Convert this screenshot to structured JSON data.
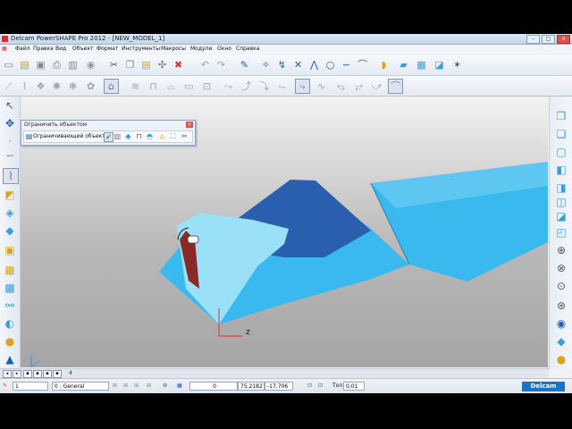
{
  "window": {
    "title": "Delcam PowerSHAPE Pro 2012 - [NEW_MODEL_1]",
    "minimize": "–",
    "maximize": "□",
    "close": "×"
  },
  "menu": [
    "Файл",
    "Правка",
    "Вид",
    "Объект",
    "Формат",
    "Инструменты",
    "Макросы",
    "Модули",
    "Окно",
    "Справка"
  ],
  "dialog": {
    "title": "Ограничить объектом",
    "close": "×",
    "limiting_label": "Ограничивающий объект"
  },
  "tabs": {
    "count_label": "4"
  },
  "status": {
    "level_value": "1",
    "layer_value": "0 : General",
    "field_value_1": "0",
    "x": "75,2182",
    "y": "-17,706",
    "tol_label": "Tол",
    "tol_value": "0,01"
  },
  "logo": {
    "text": "Delcam"
  },
  "viewport": {
    "axis_z": "Z",
    "colors": {
      "part": "#3ab9ee",
      "part_light": "#7fd3f5",
      "part_dark": "#2f7fb8",
      "highlight": "#2a5fb0",
      "inner": "#8a2a26"
    }
  },
  "icons": {
    "toolbar1": [
      "new-icon",
      "open-icon",
      "save-icon",
      "print-icon",
      "lock-icon",
      "cut-icon",
      "copy-icon",
      "paste-icon",
      "delete-icon",
      "undo-icon",
      "redo-icon",
      "edit-icon",
      "wireframe-select-icon",
      "curve-icon",
      "point-icon",
      "circle-icon",
      "spline-icon",
      "arc-icon",
      "surface-icon",
      "solid-icon",
      "assembly-icon",
      "measure-icon",
      "magic-icon"
    ],
    "toolbar2": [
      "trim-icon",
      "surface-mod-icon",
      "fillet-icon",
      "blend-icon",
      "extend-icon",
      "sweep-icon",
      "drive-icon",
      "cap-icon",
      "morph-icon",
      "offset-icon",
      "project-icon",
      "intersect-icon",
      "limit-icon",
      "split-icon",
      "join-icon",
      "rebuild-icon",
      "wrap-icon",
      "boundary-icon",
      "repair-icon"
    ]
  }
}
